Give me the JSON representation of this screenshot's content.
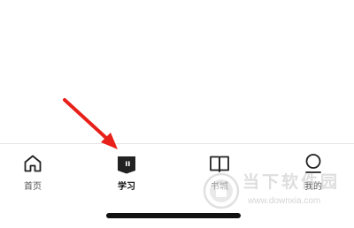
{
  "tab_bar": {
    "tabs": [
      {
        "id": "home",
        "label": "首页",
        "icon": "home-icon",
        "active": false
      },
      {
        "id": "study",
        "label": "学习",
        "icon": "study-bookmark-icon",
        "active": true
      },
      {
        "id": "bookstore",
        "label": "书城",
        "icon": "open-book-icon",
        "active": false
      },
      {
        "id": "profile",
        "label": "我的",
        "icon": "user-icon",
        "active": false
      }
    ]
  },
  "colors": {
    "active_label": "#111111",
    "inactive_label": "#555555",
    "annotation_arrow": "#e8201a",
    "home_indicator": "#111111"
  },
  "watermark": {
    "title": "当下软件园",
    "url": "www.downxia.com"
  }
}
